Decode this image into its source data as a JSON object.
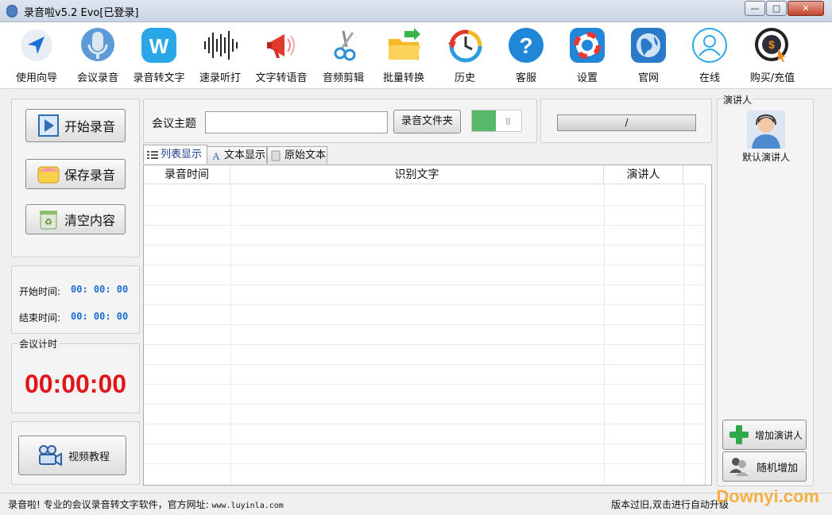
{
  "window": {
    "title": "录音啦v5.2 Evo[已登录]",
    "min": "—",
    "max": "□",
    "close": "✕"
  },
  "toolbar": [
    {
      "label": "使用向导",
      "icon": "navigation-arrow-icon"
    },
    {
      "label": "会议录音",
      "icon": "microphone-icon"
    },
    {
      "label": "录音转文字",
      "icon": "w-letter-icon"
    },
    {
      "label": "速录听打",
      "icon": "soundwave-icon"
    },
    {
      "label": "文字转语音",
      "icon": "megaphone-icon"
    },
    {
      "label": "音频剪辑",
      "icon": "scissors-icon"
    },
    {
      "label": "批量转换",
      "icon": "folder-icon"
    },
    {
      "label": "历史",
      "icon": "history-clock-icon"
    },
    {
      "label": "客服",
      "icon": "help-icon"
    },
    {
      "label": "设置",
      "icon": "settings-lifebuoy-icon"
    },
    {
      "label": "官网",
      "icon": "globe-icon"
    },
    {
      "label": "在线",
      "icon": "user-online-icon"
    },
    {
      "label": "购买/充值",
      "icon": "dollar-coin-icon"
    }
  ],
  "controls": {
    "start_record": "开始录音",
    "save_record": "保存录音",
    "clear_content": "清空内容",
    "start_time_label": "开始时间:",
    "start_time_value": "00: 00: 00",
    "end_time_label": "结束时间:",
    "end_time_value": "00: 00: 00",
    "meeting_timer_label": "会议计时",
    "meeting_timer_value": "00:00:00",
    "video_tutorial": "视频教程"
  },
  "topic": {
    "label": "会议主题",
    "value": "",
    "placeholder": "",
    "folder_button": "录音文件夹",
    "progress_text": "/"
  },
  "tabs": [
    {
      "label": "列表显示",
      "active": true
    },
    {
      "label": "文本显示",
      "active": false
    },
    {
      "label": "原始文本",
      "active": false
    }
  ],
  "table": {
    "columns": [
      "录音时间",
      "识别文字",
      "演讲人"
    ],
    "rows": []
  },
  "speakers": {
    "group_label": "演讲人",
    "items": [
      {
        "name": "默认演讲人"
      }
    ],
    "add_button": "增加演讲人",
    "random_button": "随机增加"
  },
  "statusbar": {
    "left_text": "录音啦! 专业的会议录音转文字软件，官方网址: ",
    "url": "www.luyinla.com",
    "right_text": "版本过旧,双击进行自动升级"
  },
  "watermark": "Downyi.com",
  "colors": {
    "timer": "#e0161a",
    "time_value": "#1a6fd1",
    "toggle_on": "#58b86a"
  }
}
